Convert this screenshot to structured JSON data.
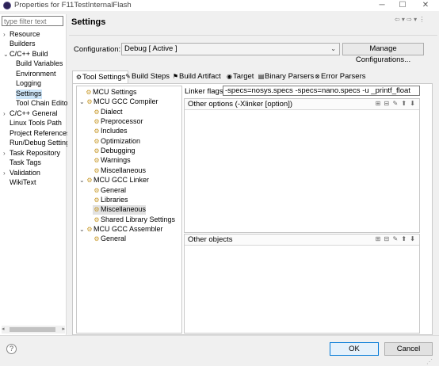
{
  "window": {
    "title": "Properties for F11TestInternalFlash",
    "minimize": "─",
    "maximize": "☐",
    "close": "✕"
  },
  "filter": {
    "placeholder": "type filter text"
  },
  "left_tree": [
    {
      "label": "Resource",
      "chev": "›"
    },
    {
      "label": "Builders",
      "chev": ""
    },
    {
      "label": "C/C++ Build",
      "chev": "⌄"
    },
    {
      "label": "Build Variables",
      "chev": ""
    },
    {
      "label": "Environment",
      "chev": ""
    },
    {
      "label": "Logging",
      "chev": ""
    },
    {
      "label": "Settings",
      "chev": ""
    },
    {
      "label": "Tool Chain Editor",
      "chev": ""
    },
    {
      "label": "C/C++ General",
      "chev": "›"
    },
    {
      "label": "Linux Tools Path",
      "chev": ""
    },
    {
      "label": "Project References",
      "chev": ""
    },
    {
      "label": "Run/Debug Settings",
      "chev": ""
    },
    {
      "label": "Task Repository",
      "chev": "›"
    },
    {
      "label": "Task Tags",
      "chev": ""
    },
    {
      "label": "Validation",
      "chev": "›"
    },
    {
      "label": "WikiText",
      "chev": ""
    }
  ],
  "page": {
    "title": "Settings",
    "nav_icons": "⇦ ▾ ⇨ ▾ ⋮"
  },
  "config": {
    "label": "Configuration:",
    "value": "Debug  [ Active ]",
    "manage_label": "Manage Configurations..."
  },
  "tabs": [
    {
      "label": "Tool Settings",
      "icon": "⚙"
    },
    {
      "label": "Build Steps",
      "icon": "✎"
    },
    {
      "label": "Build Artifact",
      "icon": "⚑"
    },
    {
      "label": "Target",
      "icon": "◉"
    },
    {
      "label": "Binary Parsers",
      "icon": "▤"
    },
    {
      "label": "Error Parsers",
      "icon": "⊗"
    }
  ],
  "tool_tree": [
    {
      "label": "MCU Settings",
      "chev": ""
    },
    {
      "label": "MCU GCC Compiler",
      "chev": "⌄"
    },
    {
      "label": "Dialect",
      "chev": ""
    },
    {
      "label": "Preprocessor",
      "chev": ""
    },
    {
      "label": "Includes",
      "chev": ""
    },
    {
      "label": "Optimization",
      "chev": ""
    },
    {
      "label": "Debugging",
      "chev": ""
    },
    {
      "label": "Warnings",
      "chev": ""
    },
    {
      "label": "Miscellaneous",
      "chev": ""
    },
    {
      "label": "MCU GCC Linker",
      "chev": "⌄"
    },
    {
      "label": "General",
      "chev": ""
    },
    {
      "label": "Libraries",
      "chev": ""
    },
    {
      "label": "Miscellaneous",
      "chev": ""
    },
    {
      "label": "Shared Library Settings",
      "chev": ""
    },
    {
      "label": "MCU GCC Assembler",
      "chev": "⌄"
    },
    {
      "label": "General",
      "chev": ""
    }
  ],
  "linker": {
    "label": "Linker flags",
    "value": "-specs=nosys.specs -specs=nano.specs -u _printf_float"
  },
  "lists": {
    "other_options": "Other options (-Xlinker [option])",
    "other_objects": "Other objects",
    "icons": "⊞ ⊟ ✎ ⬆ ⬇"
  },
  "buttons": {
    "help": "?",
    "ok": "OK",
    "cancel": "Cancel"
  }
}
